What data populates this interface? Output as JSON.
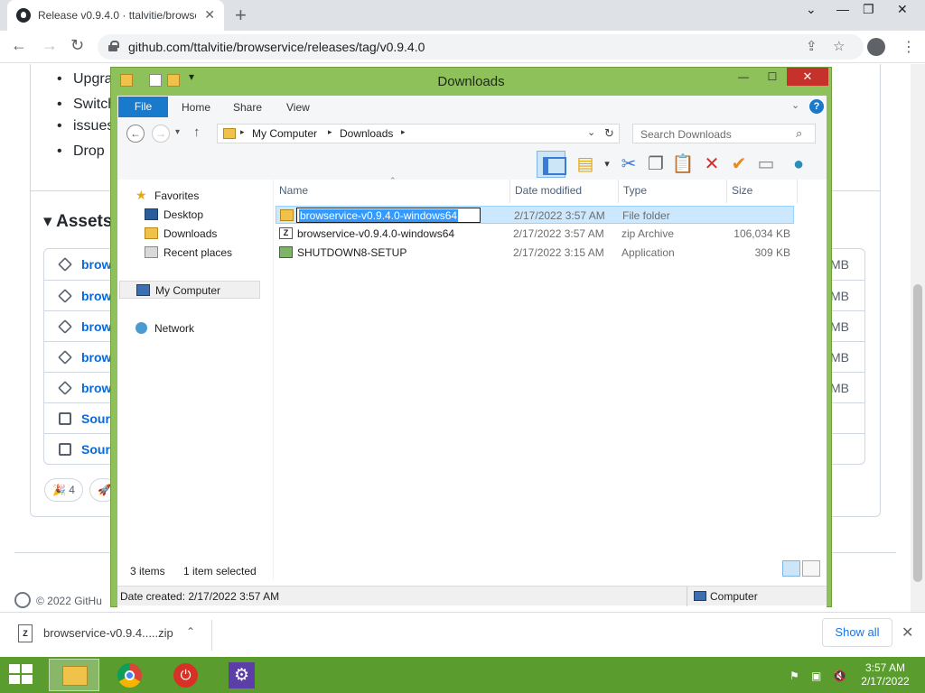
{
  "browser": {
    "tab_title": "Release v0.9.4.0 · ttalvitie/browse",
    "url": "github.com/ttalvitie/browservice/releases/tag/v0.9.4.0"
  },
  "github_page": {
    "bullets": [
      "Upgra",
      "Switch",
      "issues",
      "Drop"
    ],
    "assets_title": "Assets",
    "assets": [
      {
        "name": "brow",
        "size": "MB",
        "icon": "package-icon"
      },
      {
        "name": "brow",
        "size": "MB",
        "icon": "package-icon"
      },
      {
        "name": "brow",
        "size": "MB",
        "icon": "package-icon"
      },
      {
        "name": "brow",
        "size": "MB",
        "icon": "package-icon"
      },
      {
        "name": "brow",
        "size": "MB",
        "icon": "package-icon"
      },
      {
        "name": "Sourc",
        "size": "",
        "icon": "file-zip-icon"
      },
      {
        "name": "Sourc",
        "size": "",
        "icon": "file-zip-icon"
      }
    ],
    "reaction_count": "4",
    "footer": "© 2022 GitHu"
  },
  "explorer": {
    "title": "Downloads",
    "ribbon_tabs": [
      "File",
      "Home",
      "Share",
      "View"
    ],
    "breadcrumb": [
      "My Computer",
      "Downloads"
    ],
    "search_placeholder": "Search Downloads",
    "columns": [
      "Name",
      "Date modified",
      "Type",
      "Size"
    ],
    "nav": {
      "favorites": "Favorites",
      "desktop": "Desktop",
      "downloads": "Downloads",
      "recent": "Recent places",
      "computer": "My Computer",
      "network": "Network"
    },
    "files": [
      {
        "name": "browservice-v0.9.4.0-windows64",
        "date": "2/17/2022 3:57 AM",
        "type": "File folder",
        "size": "",
        "icon": "folder-icon",
        "selected": true,
        "renaming": true
      },
      {
        "name": "browservice-v0.9.4.0-windows64",
        "date": "2/17/2022 3:57 AM",
        "type": "zip Archive",
        "size": "106,034 KB",
        "icon": "zip-icon",
        "selected": false,
        "renaming": false
      },
      {
        "name": "SHUTDOWN8-SETUP",
        "date": "2/17/2022 3:15 AM",
        "type": "Application",
        "size": "309 KB",
        "icon": "app-icon",
        "selected": false,
        "renaming": false
      }
    ],
    "status": {
      "items": "3 items",
      "selected": "1 item selected"
    },
    "details": {
      "created": "Date created: 2/17/2022 3:57 AM",
      "location": "Computer"
    }
  },
  "download_shelf": {
    "filename": "browservice-v0.9.4.....zip",
    "show_all": "Show all"
  },
  "taskbar": {
    "time": "3:57 AM",
    "date": "2/17/2022",
    "accent": "#5a9c2e"
  }
}
